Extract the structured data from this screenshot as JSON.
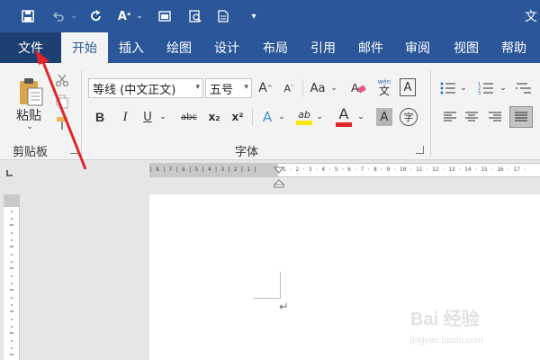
{
  "titlebar": {
    "save_icon": "save-icon",
    "undo_icon": "undo-icon",
    "redo_icon": "redo-icon",
    "right_glyph": "文"
  },
  "tabs": [
    {
      "label": "文件"
    },
    {
      "label": "开始"
    },
    {
      "label": "插入"
    },
    {
      "label": "绘图"
    },
    {
      "label": "设计"
    },
    {
      "label": "布局"
    },
    {
      "label": "引用"
    },
    {
      "label": "邮件"
    },
    {
      "label": "审阅"
    },
    {
      "label": "视图"
    },
    {
      "label": "帮助"
    }
  ],
  "ribbon": {
    "clipboard": {
      "paste_label": "粘贴",
      "group_label": "剪贴板"
    },
    "font": {
      "font_name": "等线 (中文正文)",
      "font_size": "五号",
      "grow": "A",
      "shrink": "A",
      "case": "Aa",
      "pinyin_top": "wén",
      "pinyin_bottom": "文",
      "border_char": "A",
      "bold": "B",
      "italic": "I",
      "underline": "U",
      "strike": "abc",
      "subscript": "x₂",
      "superscript": "x²",
      "effects": "A",
      "highlight": "ab",
      "font_color": "A",
      "shading": "A",
      "enclose": "字",
      "group_label": "字体"
    }
  },
  "ruler": {
    "margin_ticks": "| 8 | 7 | 6 | 5 | 4 | 3 | 2 | 1 |",
    "body_ticks": "1 · 2 · 3 · 4 · 5 · 6 · 7 · 8 · 9 · 10 · 11 · 12 · 13 · 14 · 15 · 16 · 17 ·"
  },
  "document": {
    "paragraph_mark": "↵"
  },
  "watermark": {
    "brand": "Bai 经验",
    "url": "jingyan.baidu.com"
  },
  "colors": {
    "title_bar": "#2b579a",
    "file_tab": "#1e3f74",
    "arrow": "#e0262a",
    "highlight_yellow": "#ffe600",
    "font_red": "#e0262a"
  }
}
